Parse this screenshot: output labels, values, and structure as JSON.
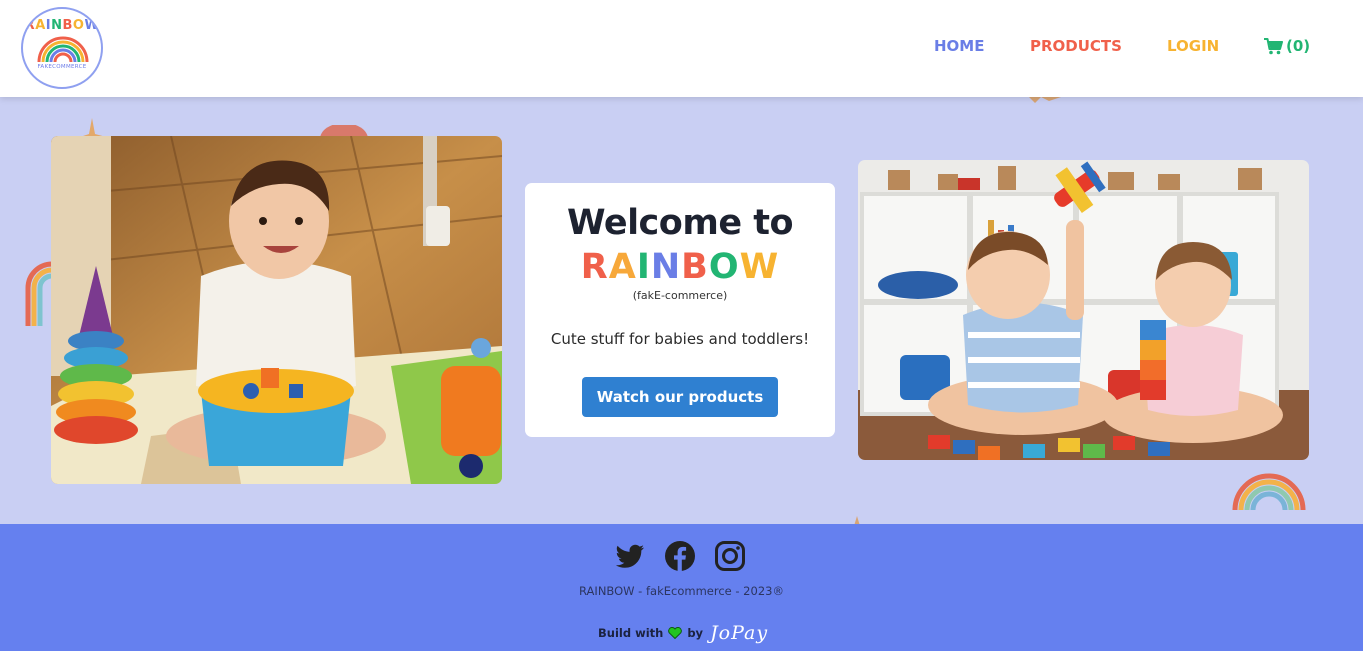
{
  "logo": {
    "word": "RAINBOW",
    "sub": "FAKECOMMERCE",
    "letter_colors": [
      "#f0604a",
      "#f7b331",
      "#6a7ee6",
      "#22b573",
      "#f0604a",
      "#f7b331",
      "#6a7ee6"
    ]
  },
  "nav": {
    "home": "HOME",
    "products": "PRODUCTS",
    "login": "LOGIN",
    "cart_count": "(0)"
  },
  "hero": {
    "title": "Welcome to",
    "brand_letters": [
      {
        "ch": "R",
        "color": "#f0604a"
      },
      {
        "ch": "A",
        "color": "#f7a83a"
      },
      {
        "ch": "I",
        "color": "#22b573"
      },
      {
        "ch": "N",
        "color": "#6a7ee6"
      },
      {
        "ch": "B",
        "color": "#f0604a"
      },
      {
        "ch": "O",
        "color": "#22b573"
      },
      {
        "ch": "W",
        "color": "#f7b331"
      }
    ],
    "subtitle": "(fakE-commerce)",
    "tagline": "Cute stuff for babies and toddlers!",
    "button": "Watch our products"
  },
  "footer": {
    "copyright": "RAINBOW - fakEcommerce - 2023®",
    "build_with": "Build with",
    "by": "by",
    "signature": "JoPay"
  },
  "colors": {
    "background": "#c9cff3",
    "footer": "#6580ef",
    "button": "#2f80d1"
  }
}
